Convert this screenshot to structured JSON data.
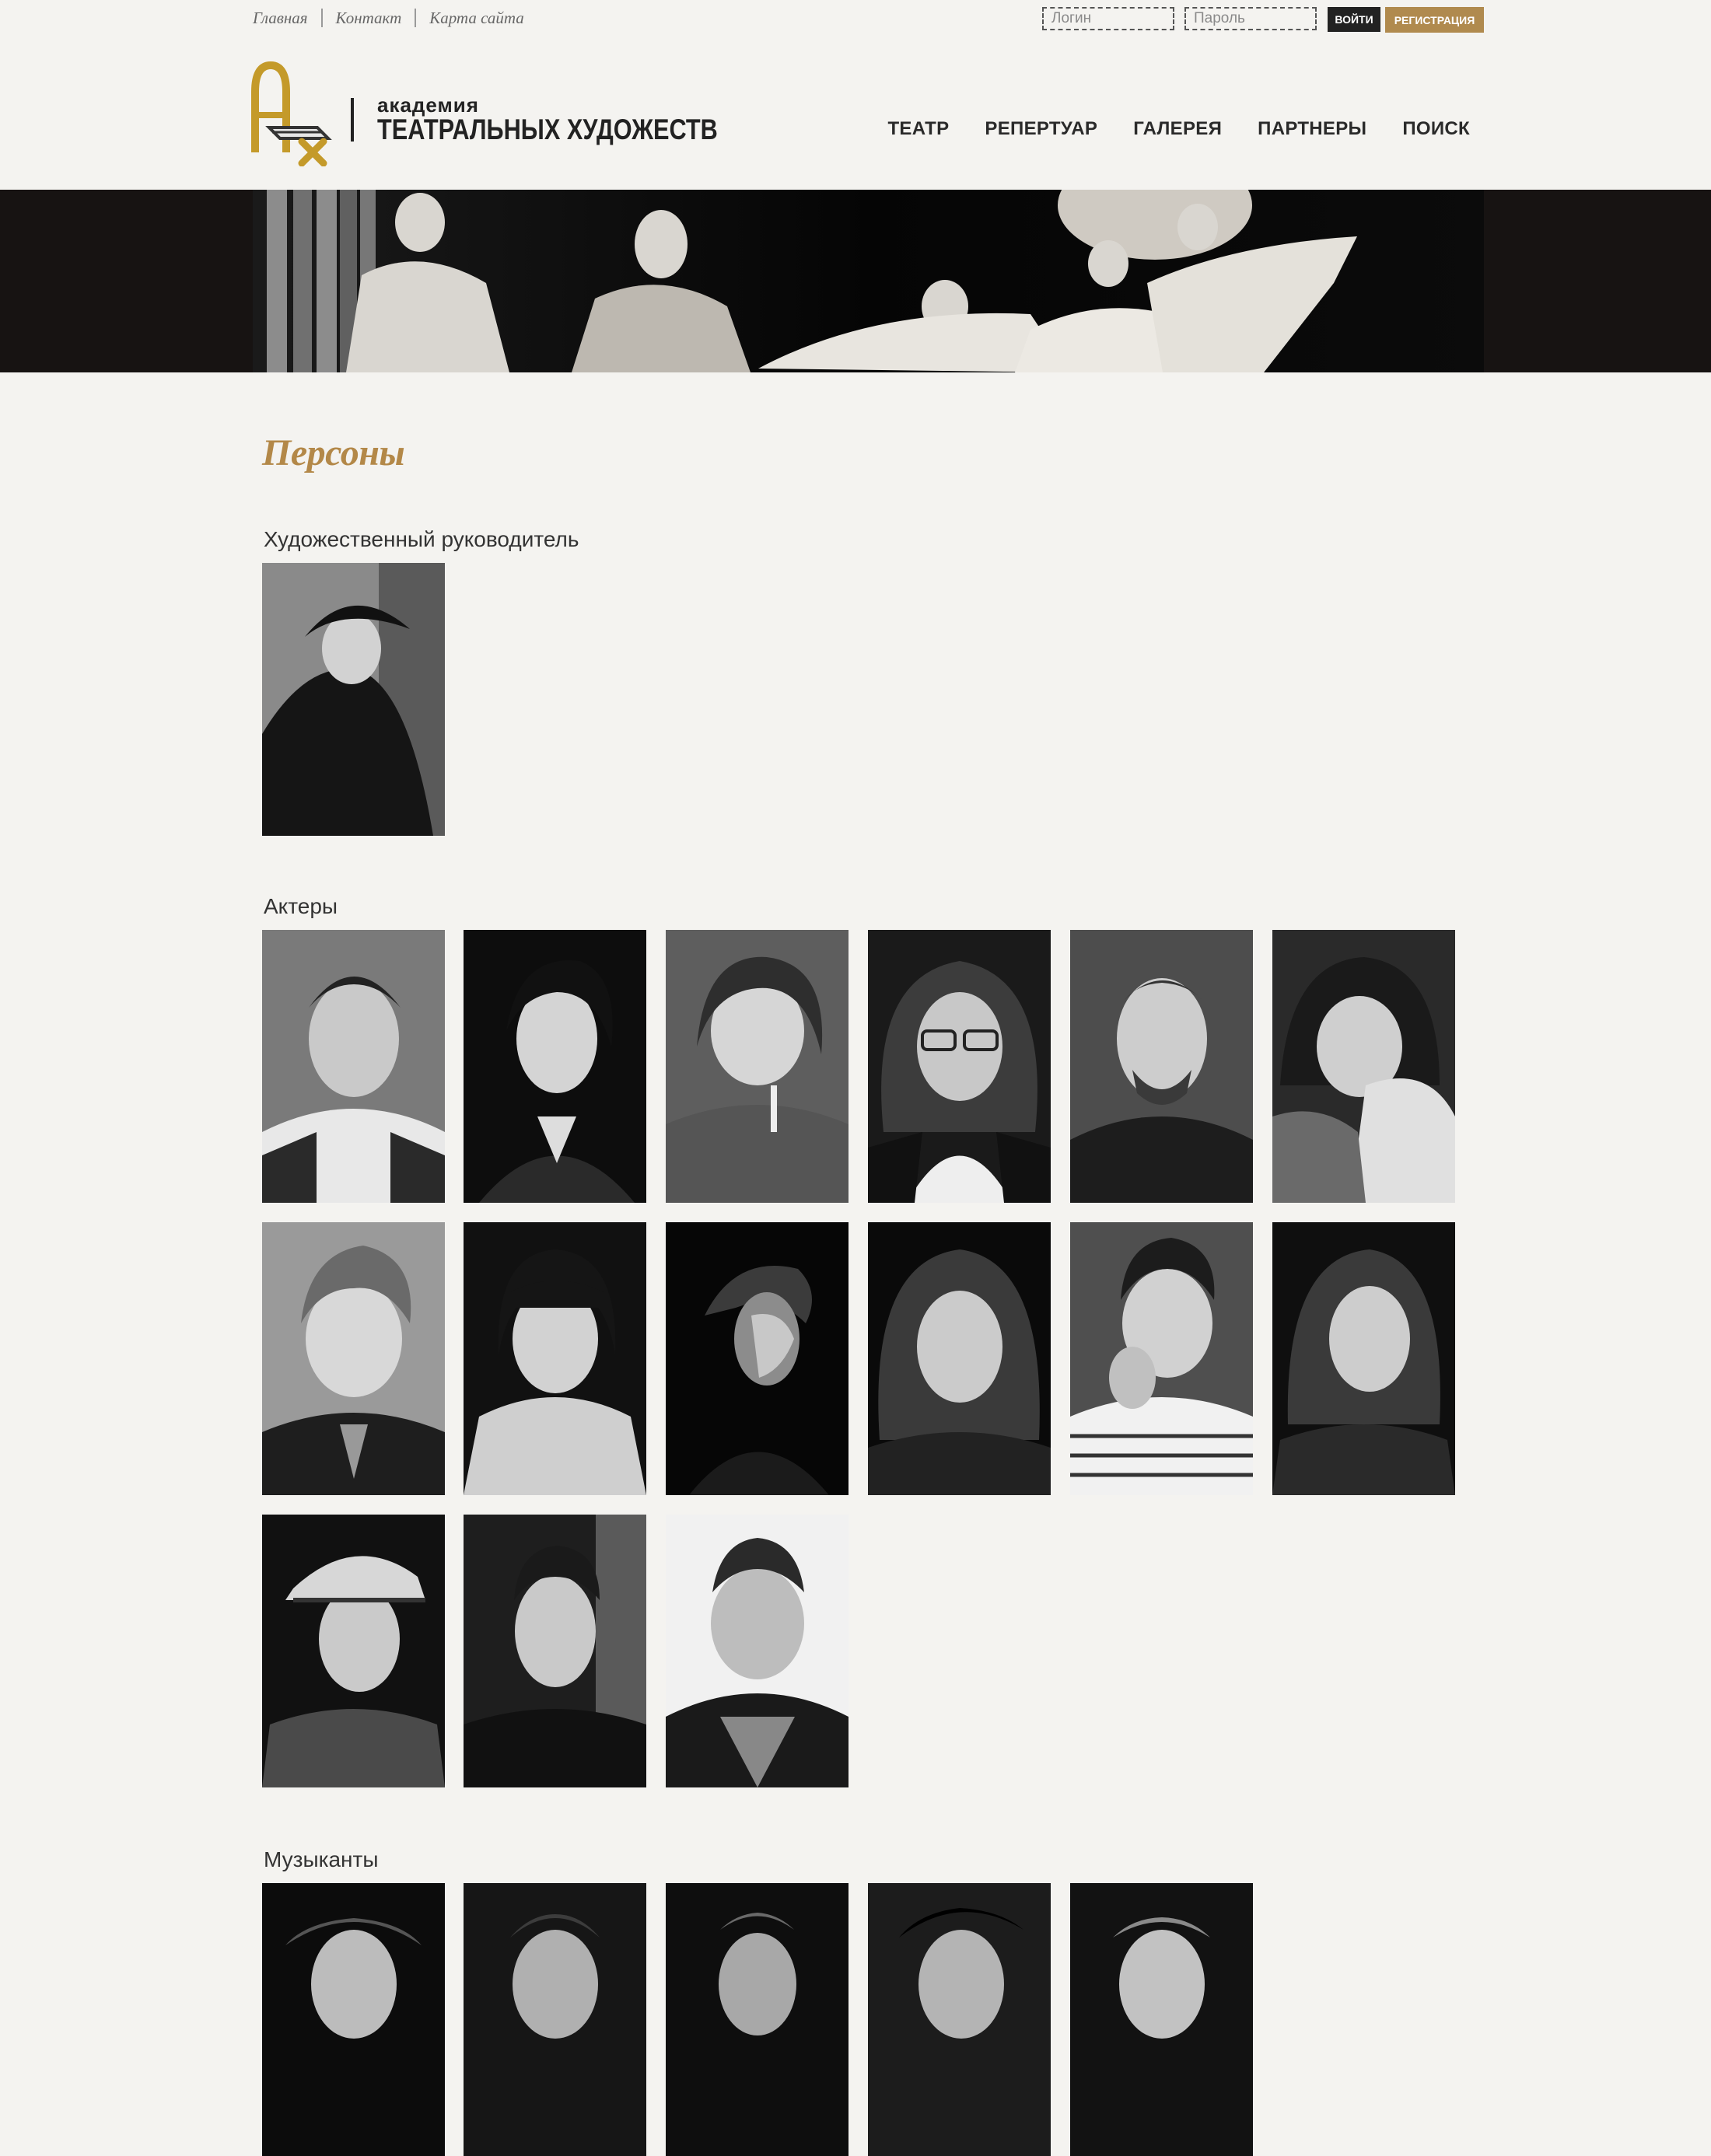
{
  "topbar": {
    "links": [
      "Главная",
      "Контакт",
      "Карта сайта"
    ],
    "login_placeholder": "Логин",
    "password_placeholder": "Пароль",
    "login_button": "ВОЙТИ",
    "register_button": "РЕГИСТРАЦИЯ"
  },
  "logo": {
    "line1": "академия",
    "line2": "ТЕАТРАЛЬНЫХ ХУДОЖЕСТВ"
  },
  "nav": [
    "ТЕАТР",
    "РЕПЕРТУАР",
    "ГАЛЕРЕЯ",
    "ПАРТНЕРЫ",
    "ПОИСК"
  ],
  "page_title": "Персоны",
  "sections": {
    "director": "Художественный руководитель",
    "actors": "Актеры",
    "musicians": "Музыканты"
  },
  "colors": {
    "accent": "#b08a4e",
    "background": "#f4f3f0",
    "dark": "#222222"
  }
}
